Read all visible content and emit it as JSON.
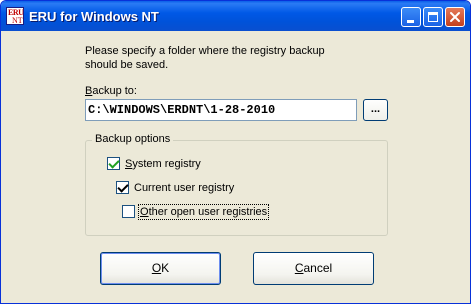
{
  "window": {
    "title": "ERU for Windows NT",
    "icon_text_top": "ERU",
    "icon_text_bottom": "NT"
  },
  "titlebar_buttons": {
    "minimize": "minimize-icon",
    "maximize": "maximize-icon",
    "close": "close-icon"
  },
  "dialog": {
    "prompt_line1": "Please specify a folder where the registry backup",
    "prompt_line2": "should be saved.",
    "backup_label_mnemonic": "B",
    "backup_label_rest": "ackup to:",
    "backup_path": "C:\\WINDOWS\\ERDNT\\1-28-2010",
    "browse_label": "...",
    "group_title": "Backup options",
    "options": [
      {
        "label": "System registry",
        "mnemonic": "S",
        "rest": "ystem registry",
        "checked": true
      },
      {
        "label": "Current user registry",
        "checked": true
      },
      {
        "label": "Other open user registries",
        "mnemonic": "O",
        "rest": "ther open user registries",
        "checked": false
      }
    ],
    "ok_mnemonic": "O",
    "ok_rest": "K",
    "cancel_mnemonic": "C",
    "cancel_rest": "ancel"
  },
  "colors": {
    "titlebar": "#0058e6",
    "face": "#ece9d8",
    "checkmark": "#21a121"
  }
}
